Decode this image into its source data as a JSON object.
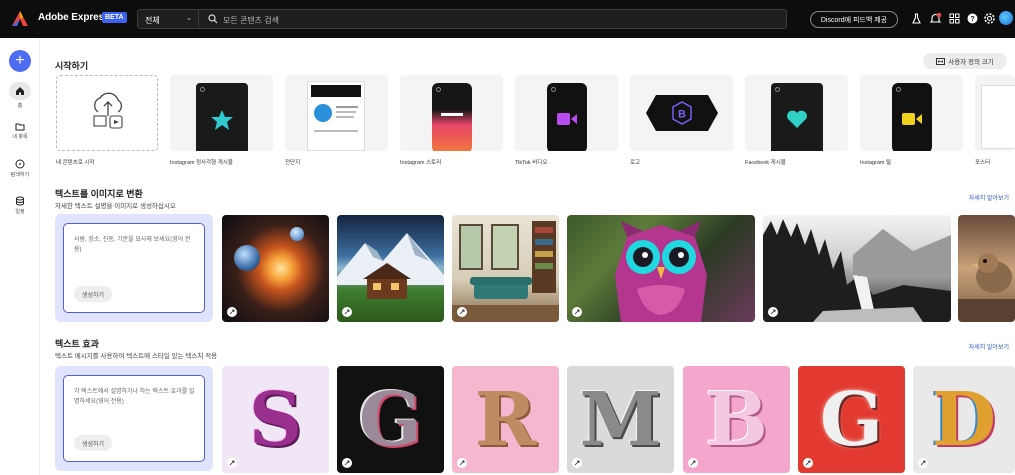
{
  "topbar": {
    "app_name": "Adobe Express",
    "beta_badge": "BETA",
    "scope_value": "전체",
    "search_placeholder": "모든 콘텐츠 검색",
    "discord_label": "Discord에 피드백 제공"
  },
  "rail": {
    "create_symbol": "+",
    "items": [
      {
        "label": "홈",
        "icon": "home-icon"
      },
      {
        "label": "내 항목",
        "icon": "folder-icon"
      },
      {
        "label": "탐색하기",
        "icon": "compass-icon"
      },
      {
        "label": "일정",
        "icon": "database-icon"
      }
    ]
  },
  "start": {
    "title": "시작하기",
    "custom_size_label": "사용자 정의 크기",
    "cards": [
      {
        "label": "내 콘텐츠로 시작"
      },
      {
        "label": "Instagram 정사각형 게시물"
      },
      {
        "label": "전단지"
      },
      {
        "label": "Instagram 스토리"
      },
      {
        "label": "TikTok 비디오"
      },
      {
        "label": "로고"
      },
      {
        "label": "Facebook 게시물"
      },
      {
        "label": "Instagram 릴"
      },
      {
        "label": "포스터"
      }
    ]
  },
  "text_to_image": {
    "title": "텍스트를 이미지로 변환",
    "subtitle": "자세한 텍스트 설명을 이미지로 생성하십시오",
    "see_all": "자세히 알아보기",
    "prompt_placeholder": "사람, 장소, 진동, 기분을 묘사해 보세요(영어 전용)",
    "generate_label": "생성하기"
  },
  "text_effects": {
    "title": "텍스트 효과",
    "subtitle": "텍스트 메시지를 사용하여 텍스트에 스타일 있는 텍스처 적용",
    "see_all": "자세히 알아보기",
    "prompt_placeholder": "각 텍스트에서 설명하거나 하는 텍스트 효과를 설명하세요(영어 전용)",
    "generate_label": "생성하기",
    "letters": [
      "S",
      "G",
      "R",
      "M",
      "B",
      "G",
      "D"
    ]
  },
  "colors": {
    "accent": "#4e6cf0",
    "topbar": "#0d0d0d",
    "prompt_bg": "#dfe3fb"
  }
}
